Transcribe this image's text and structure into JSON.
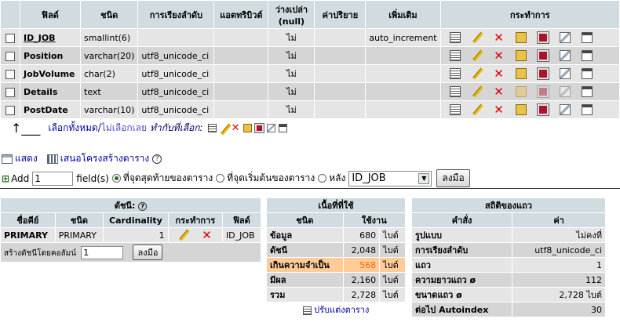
{
  "structure": {
    "headers": [
      "ฟิลด์",
      "ชนิด",
      "การเรียงลำดับ",
      "แอตทริบิวต์",
      "ว่างเปล่า (null)",
      "ค่าปริยาย",
      "เพิ่มเติม",
      "กระทำการ"
    ],
    "null_header_line1": "ว่างเปล่า",
    "null_header_line2": "(null)",
    "rows": [
      {
        "field": "ID_JOB",
        "type": "smallint(6)",
        "collation": "",
        "attributes": "",
        "null": "ไม่",
        "default": "",
        "extra": "auto_increment"
      },
      {
        "field": "Position",
        "type": "varchar(20)",
        "collation": "utf8_unicode_ci",
        "attributes": "",
        "null": "ไม่",
        "default": "",
        "extra": ""
      },
      {
        "field": "JobVolume",
        "type": "char(2)",
        "collation": "utf8_unicode_ci",
        "attributes": "",
        "null": "ไม่",
        "default": "",
        "extra": ""
      },
      {
        "field": "Details",
        "type": "text",
        "collation": "utf8_unicode_ci",
        "attributes": "",
        "null": "ไม่",
        "default": "",
        "extra": ""
      },
      {
        "field": "PostDate",
        "type": "varchar(10)",
        "collation": "utf8_unicode_ci",
        "attributes": "",
        "null": "ไม่",
        "default": "",
        "extra": ""
      }
    ],
    "action_icons": [
      "browse-icon",
      "edit-icon",
      "delete-icon",
      "primary-icon",
      "unique-icon",
      "index-icon",
      "fulltext-icon"
    ]
  },
  "check_all": {
    "select_all": "เลือกทั้งหมด",
    "separator": " / ",
    "deselect_all": "ไม่เลือกเลย",
    "with_selected": "ทำกับที่เลือก:"
  },
  "links": {
    "print_view": "แสดง",
    "propose_structure": "เสนอโครงสร้างตาราง"
  },
  "add_field": {
    "add_label": "Add",
    "count_value": "1",
    "fields_label": "field(s)",
    "opt_end": "ที่จุดสุดท้ายของตาราง",
    "opt_begin": "ที่จุดเริ่มต้นของตาราง",
    "opt_after": "หลัง",
    "after_select": "ID_JOB",
    "go_button": "ลงมือ"
  },
  "indexes": {
    "title": "ดัชนี:",
    "headers": [
      "ชื่อคีย์",
      "ชนิด",
      "Cardinality",
      "กระทำการ",
      "ฟิลด์"
    ],
    "rows": [
      {
        "keyname": "PRIMARY",
        "type": "PRIMARY",
        "cardinality": "1",
        "field": "ID_JOB"
      }
    ],
    "create_label": "สร้างดัชนีโดยคอลัมน์",
    "create_value": "1",
    "create_button": "ลงมือ"
  },
  "space": {
    "title": "เนื้อที่ที่ใช้",
    "headers": [
      "ชนิด",
      "ใช้งาน"
    ],
    "rows": [
      {
        "label": "ข้อมูล",
        "value": "680",
        "unit": "ไบต์"
      },
      {
        "label": "ดัชนี",
        "value": "2,048",
        "unit": "ไบต์"
      },
      {
        "label": "เกินความจำเป็น",
        "value": "568",
        "unit": "ไบต์",
        "highlight": true
      },
      {
        "label": "มีผล",
        "value": "2,160",
        "unit": "ไบต์"
      },
      {
        "label": "รวม",
        "value": "2,728",
        "unit": "ไบต์"
      }
    ],
    "optimize_link": "ปรับแต่งตาราง"
  },
  "stats": {
    "title": "สถิติของแถว",
    "headers": [
      "คำสั่ง",
      "ค่า"
    ],
    "rows": [
      {
        "label": "รูปแบบ",
        "value": "ไม่คงที่"
      },
      {
        "label": "การเรียงลำดับ",
        "value": "utf8_unicode_ci"
      },
      {
        "label": "แถว",
        "value": "1"
      },
      {
        "label": "ความยาวแถว ø",
        "value": "112"
      },
      {
        "label": "ขนาดแถว ø",
        "value": "2,728 ไบต์"
      },
      {
        "label": "ต่อไป Autoindex",
        "value": "30"
      }
    ]
  },
  "colors": {
    "header_bg": "#d0dce0",
    "row_odd": "#e5e5e5",
    "row_even": "#d5d5d5",
    "highlight_row": "#ffcc99",
    "link": "#0000a0"
  }
}
